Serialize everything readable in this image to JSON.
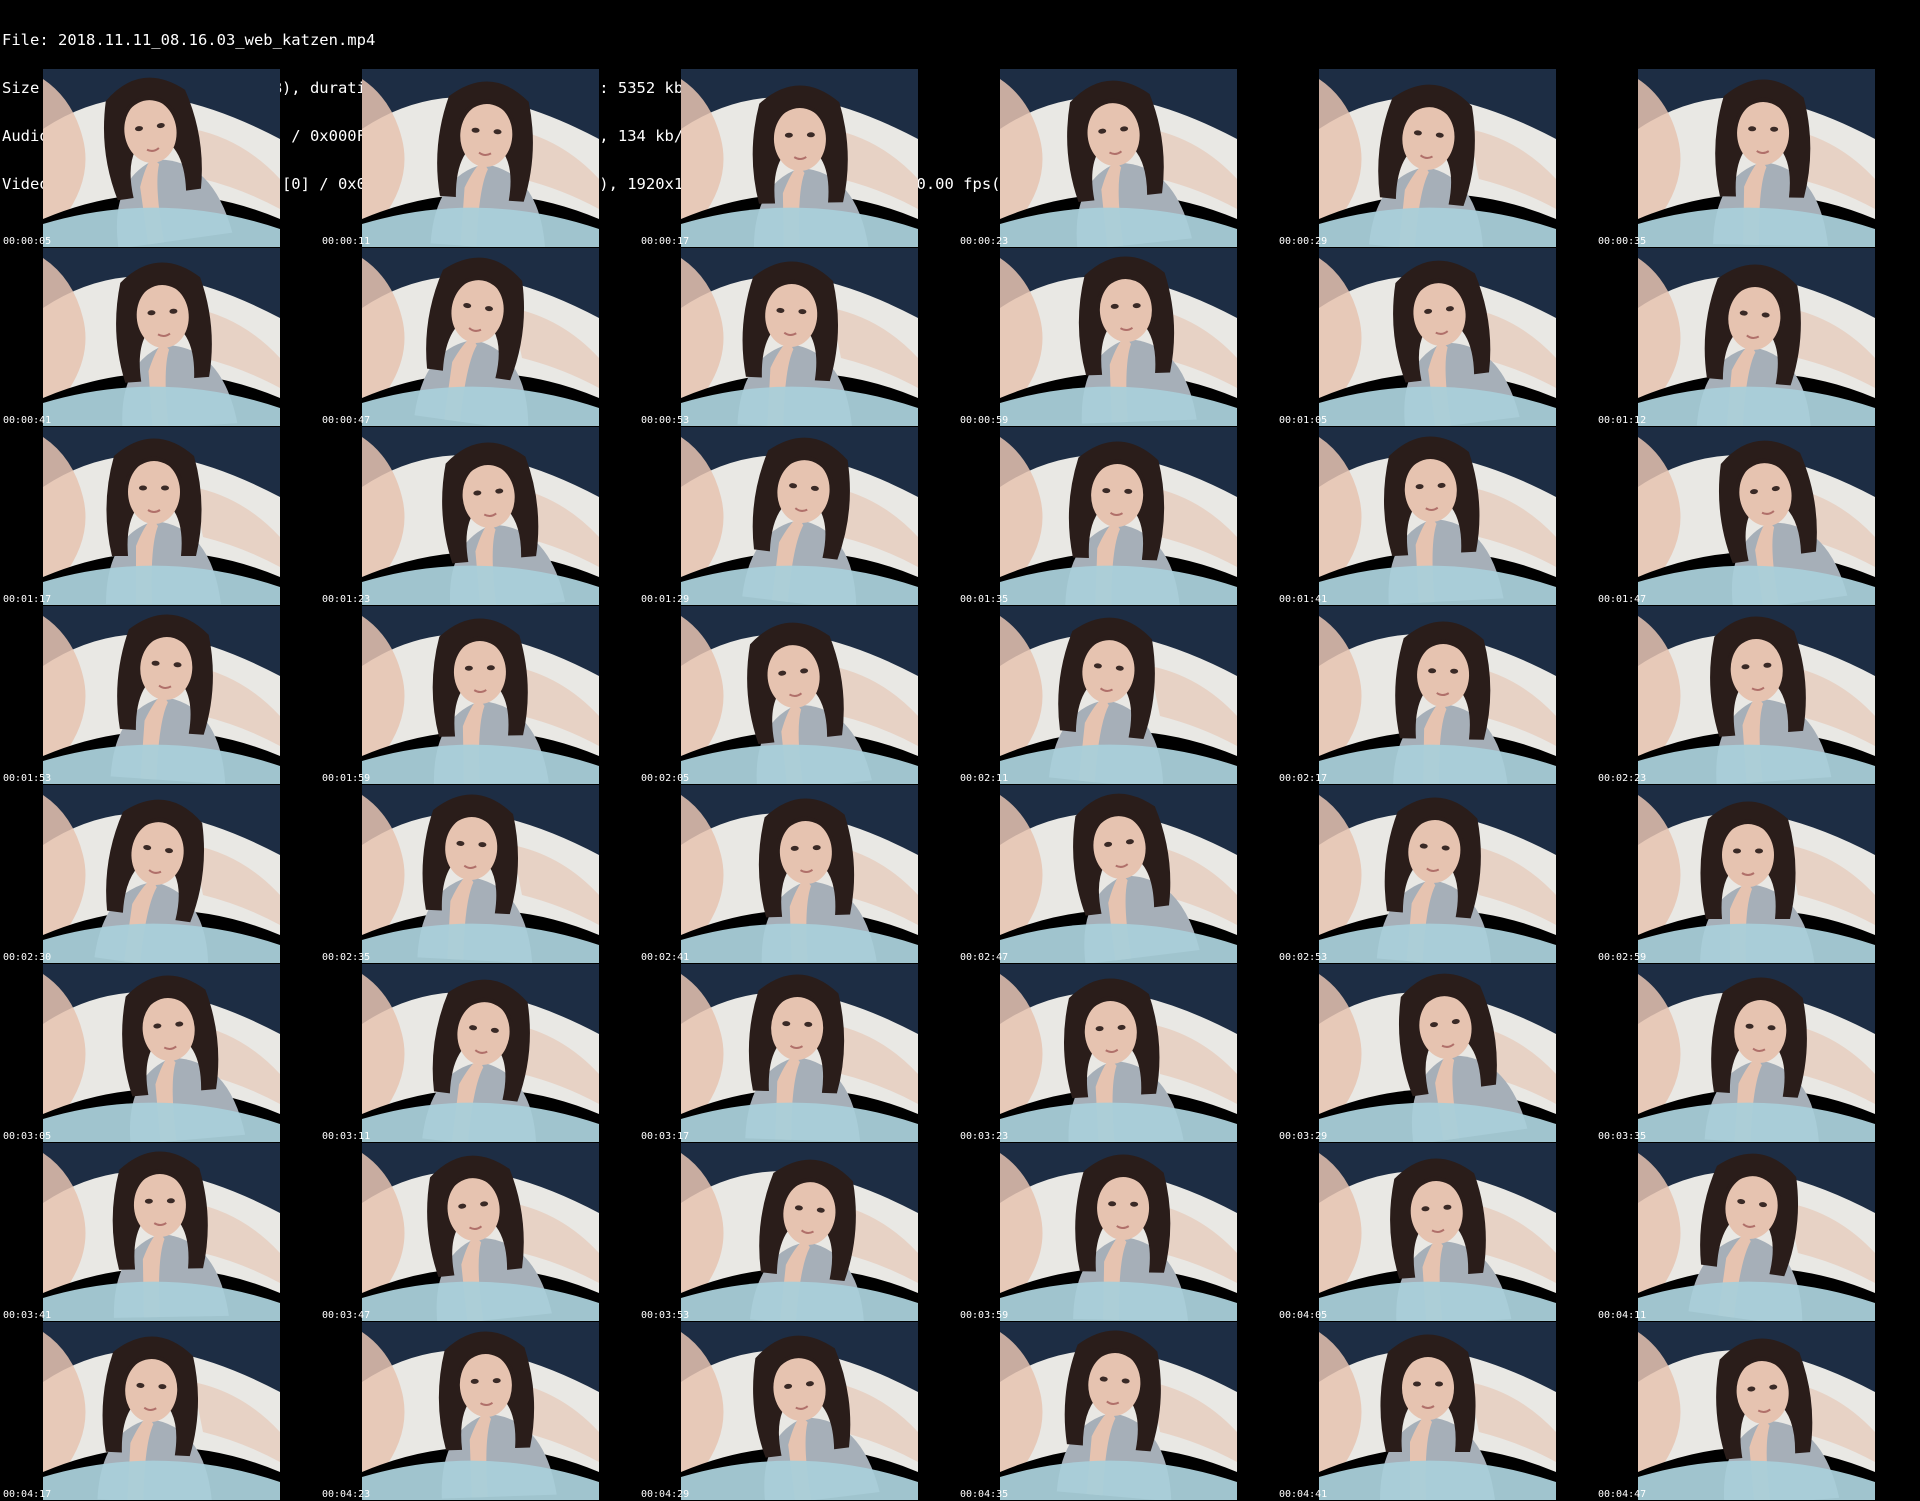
{
  "header": {
    "lines": [
      "File: 2018.11.11_08.16.03_web_katzen.mp4",
      "Size: 198700020 bytes (189 MiB), duration: 00:04:57, avg.bitrate: 5352 kb/s",
      "Audio: aac (LC) ([15][0][0][0] / 0x000F), 44100 Hz, stereo, fltp, 134 kb/s",
      "Video: h264 (High) ([27][0][0][0] / 0x001B), yuv420p(progressive), 1920x1080 [SAR 1:1 DAR 16:9], 30.00 fps(r)"
    ]
  },
  "thumbnail_icon": "video-frame-thumbnail",
  "colors": {
    "background": "#000000",
    "text": "#ffffff",
    "curtain": "#1d2d44",
    "blanket": "#e9e8e4",
    "skirt": "#a9cfd9",
    "hoodie": "#a6afb8",
    "hair": "#2a1d1a",
    "skin": "#e6c3b0"
  },
  "timestamps": [
    "00:00:05",
    "00:00:11",
    "00:00:17",
    "00:00:23",
    "00:00:29",
    "00:00:35",
    "00:00:41",
    "00:00:47",
    "00:00:53",
    "00:00:59",
    "00:01:05",
    "00:01:12",
    "00:01:17",
    "00:01:23",
    "00:01:29",
    "00:01:35",
    "00:01:41",
    "00:01:47",
    "00:01:53",
    "00:01:59",
    "00:02:05",
    "00:02:11",
    "00:02:17",
    "00:02:23",
    "00:02:30",
    "00:02:35",
    "00:02:41",
    "00:02:47",
    "00:02:53",
    "00:02:59",
    "00:03:05",
    "00:03:11",
    "00:03:17",
    "00:03:23",
    "00:03:29",
    "00:03:35",
    "00:03:41",
    "00:03:47",
    "00:03:53",
    "00:03:59",
    "00:04:05",
    "00:04:11",
    "00:04:17",
    "00:04:23",
    "00:04:29",
    "00:04:35",
    "00:04:41",
    "00:04:47"
  ]
}
